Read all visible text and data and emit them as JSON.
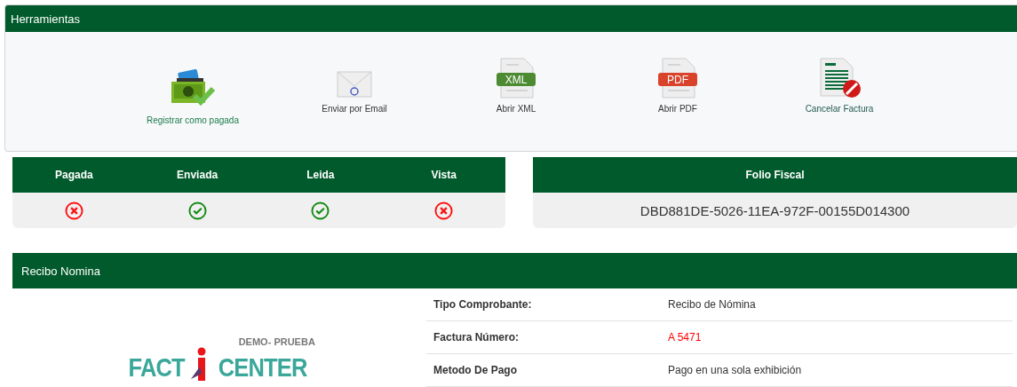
{
  "tools_panel": {
    "title": "Herramientas",
    "tools": [
      {
        "kind": "pay",
        "label": "Registrar como pagada"
      },
      {
        "kind": "email",
        "label": "Enviar por Email"
      },
      {
        "kind": "xml",
        "label": "Abrir XML",
        "badge": "XML"
      },
      {
        "kind": "pdf",
        "label": "Abrir PDF",
        "badge": "PDF"
      },
      {
        "kind": "cancel",
        "label": "Cancelar Factura"
      }
    ]
  },
  "status": [
    {
      "label": "Pagada",
      "done": false
    },
    {
      "label": "Enviada",
      "done": true
    },
    {
      "label": "Leida",
      "done": true
    },
    {
      "label": "Vista",
      "done": false
    }
  ],
  "folio": {
    "title": "Folio Fiscal",
    "value": "DBD881DE-5026-11EA-972F-00155D014300"
  },
  "receipt": {
    "title": "Recibo Nomina",
    "logo": {
      "tagline": "DEMO- PRUEBA",
      "left": "FACT",
      "right": "CENTER"
    },
    "rows": [
      {
        "label": "Tipo Comprobante:",
        "value": "Recibo de Nómina",
        "emphasis": false
      },
      {
        "label": "Factura Número:",
        "value": "A 5471",
        "emphasis": true
      },
      {
        "label": "Metodo De Pago",
        "value": "Pago en una sola exhibición",
        "emphasis": false
      }
    ]
  }
}
